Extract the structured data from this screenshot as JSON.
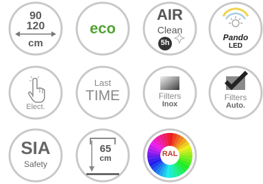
{
  "badges": {
    "size": {
      "top": "90",
      "middle": "120",
      "unit": "cm"
    },
    "eco": {
      "label": "eco"
    },
    "air_clean": {
      "title": "AIR",
      "subtitle": "Clean",
      "hours": "5h"
    },
    "pando_led": {
      "brand": "Pando",
      "type": "LED"
    },
    "elect": {
      "label": "Elect."
    },
    "last_time": {
      "line1": "Last",
      "line2": "TIME"
    },
    "filters_inox": {
      "line1": "Filters",
      "line2": "Inox"
    },
    "filters_auto": {
      "line1": "Filters",
      "line2": "Auto."
    },
    "sia_safety": {
      "title": "SIA",
      "subtitle": "Safety"
    },
    "height": {
      "value": "65",
      "unit": "cm"
    },
    "ral": {
      "label": "RAL"
    }
  },
  "colors": {
    "gray": "#888888",
    "ring": "#c8c8c8",
    "eco_green": "#53a334",
    "dark": "#222222"
  }
}
